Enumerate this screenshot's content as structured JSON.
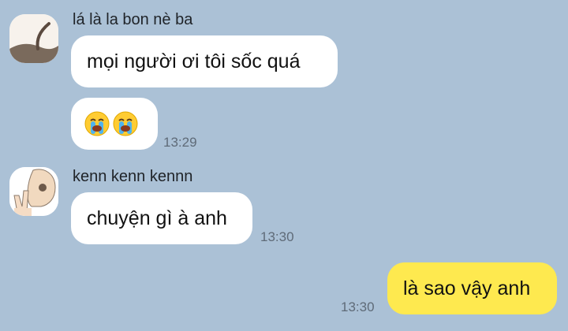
{
  "chat": {
    "messages": [
      {
        "sender": "lá là la bon nè ba",
        "text": "mọi người ơi tôi sốc quá"
      },
      {
        "sender": "lá là la bon nè ba",
        "text": "😭😭",
        "time": "13:29"
      },
      {
        "sender": "kenn kenn kennn",
        "text": "chuyện gì à anh",
        "time": "13:30"
      },
      {
        "text": "là sao vậy anh",
        "time": "13:30",
        "mine": true
      }
    ]
  },
  "icons": {
    "avatar1": "leaf-stem-avatar",
    "avatar2": "peace-sign-avatar",
    "emoji": "loudly-crying-face-emoji"
  },
  "colors": {
    "background": "#abc1d6",
    "incoming_bubble": "#ffffff",
    "outgoing_bubble": "#fee94f"
  }
}
